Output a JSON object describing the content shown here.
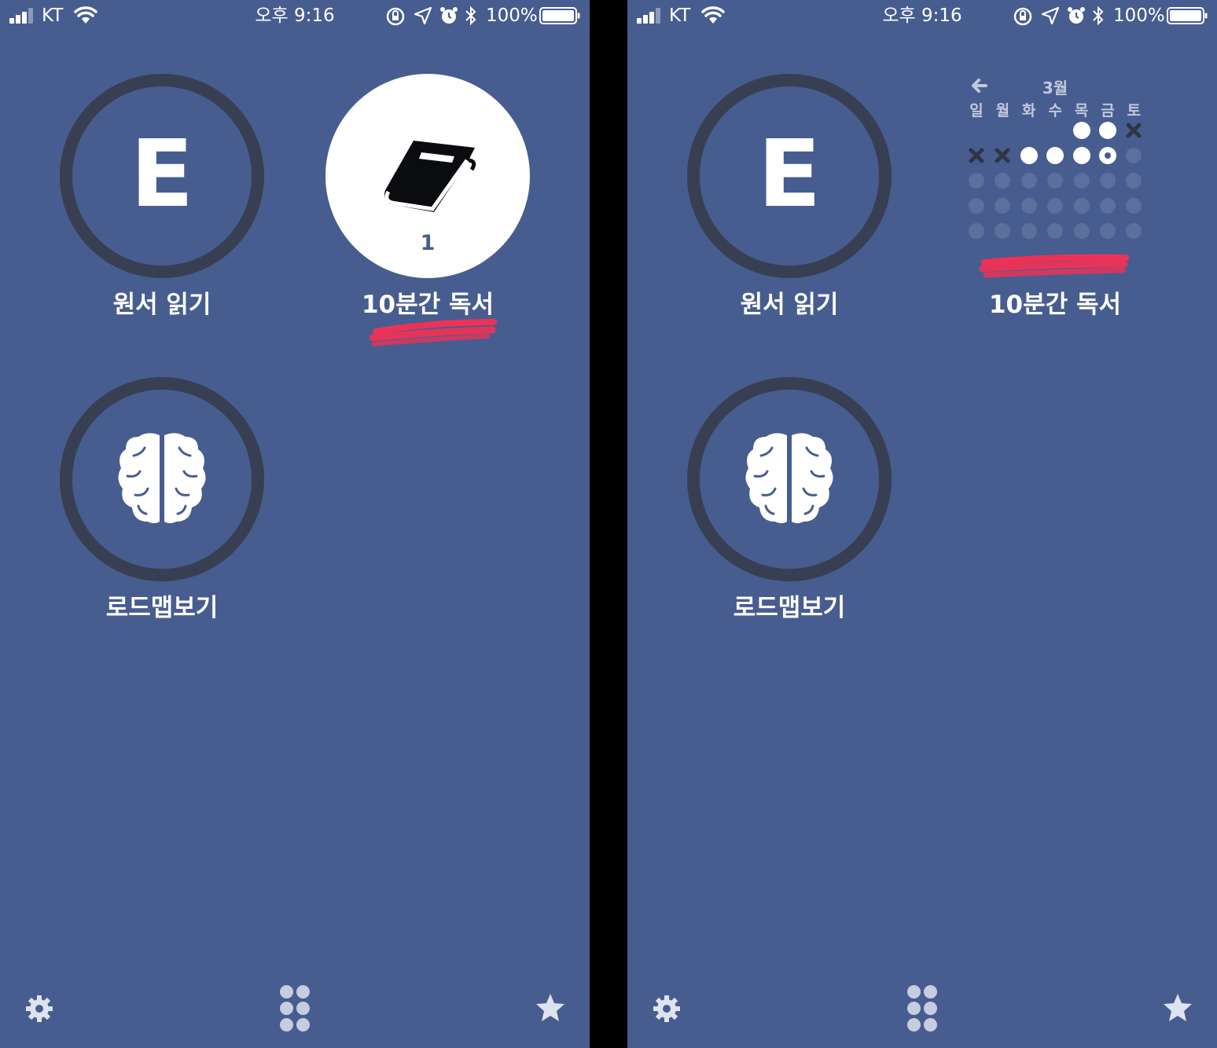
{
  "screens": [
    {
      "status": {
        "carrier": "KT",
        "time": "오후 9:16",
        "battery": "100%"
      },
      "tiles": [
        {
          "icon": "letter",
          "letter": "E",
          "label": "원서 읽기"
        },
        {
          "icon": "book-icon",
          "count": "1",
          "label": "10분간 독서",
          "highlighted": true
        },
        {
          "icon": "brain-icon",
          "label": "로드맵보기"
        }
      ]
    },
    {
      "status": {
        "carrier": "KT",
        "time": "오후 9:16",
        "battery": "100%"
      },
      "tiles": [
        {
          "icon": "letter",
          "letter": "E",
          "label": "원서 읽기"
        },
        {
          "icon": "calendar",
          "label": "10분간 독서"
        },
        {
          "icon": "brain-icon",
          "label": "로드맵보기"
        }
      ],
      "calendar": {
        "month": "3월",
        "weekdays": [
          "일",
          "월",
          "화",
          "수",
          "목",
          "금",
          "토"
        ],
        "rows": [
          [
            "blank",
            "blank",
            "blank",
            "blank",
            "done",
            "done",
            "missed"
          ],
          [
            "missed",
            "missed",
            "done",
            "done",
            "done",
            "today",
            "future"
          ],
          [
            "future",
            "future",
            "future",
            "future",
            "future",
            "future",
            "future"
          ],
          [
            "future",
            "future",
            "future",
            "future",
            "future",
            "future",
            "future"
          ],
          [
            "future",
            "future",
            "future",
            "future",
            "future",
            "future",
            "future"
          ]
        ]
      }
    }
  ],
  "toolbar": {
    "left_icon": "gear-icon",
    "center_icon": "grid-dots-icon",
    "right_icon": "star-icon"
  },
  "colors": {
    "background": "#475d90",
    "ring": "#383f53",
    "accent_stroke": "#ff2e50",
    "dot_empty": "#5c6f9d"
  }
}
